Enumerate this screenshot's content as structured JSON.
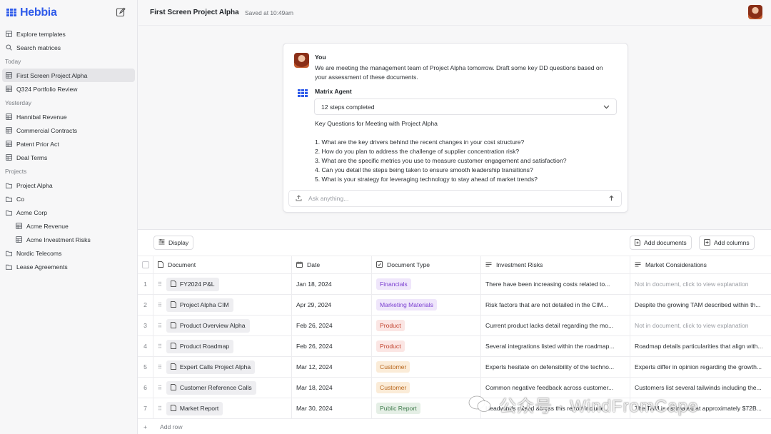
{
  "app": {
    "name": "Hebbia"
  },
  "sidebar": {
    "top_items": [
      {
        "label": "Explore templates",
        "icon": "template-icon"
      },
      {
        "label": "Search matrices",
        "icon": "search-icon"
      }
    ],
    "sections": {
      "today": "Today",
      "yesterday": "Yesterday",
      "projects": "Projects"
    },
    "today_items": [
      {
        "label": "First Screen Project Alpha",
        "active": true
      },
      {
        "label": "Q324 Portfolio Review"
      }
    ],
    "yesterday_items": [
      {
        "label": "Hannibal Revenue"
      },
      {
        "label": "Commercial Contracts"
      },
      {
        "label": "Patent Prior Act"
      },
      {
        "label": "Deal Terms"
      }
    ],
    "project_items": [
      {
        "label": "Project Alpha"
      },
      {
        "label": "Co"
      },
      {
        "label": "Acme Corp"
      },
      {
        "label": "Acme Revenue"
      },
      {
        "label": "Acme Investment Risks"
      },
      {
        "label": "Nordic Telecoms"
      },
      {
        "label": "Lease Agreements"
      }
    ]
  },
  "header": {
    "title": "First Screen Project Alpha",
    "saved": "Saved at 10:49am"
  },
  "chat": {
    "user_name": "You",
    "user_message": "We are meeting the management team of Project Alpha tomorrow. Draft some key DD questions based on your assessment of these documents.",
    "agent_name": "Matrix Agent",
    "steps_label": "12 steps completed",
    "answer_heading": "Key Questions for Meeting with Project Alpha",
    "questions": [
      "1. What are the key drivers behind the recent changes in your cost structure?",
      "2. How do you plan to address the challenge of supplier concentration risk?",
      "3. What are the specific metrics you use to measure customer engagement and satisfaction?",
      "4. Can you detail the steps being taken to ensure smooth leadership transitions?",
      "5. What is your strategy for leveraging technology to stay ahead of market trends?"
    ],
    "ask_placeholder": "Ask anything..."
  },
  "toolbar": {
    "display": "Display",
    "add_documents": "Add documents",
    "add_columns": "Add columns"
  },
  "table": {
    "columns": [
      "Document",
      "Date",
      "Document Type",
      "Investment Risks",
      "Market Considerations"
    ],
    "rows": [
      {
        "num": "1",
        "doc": "FY2024 P&L",
        "date": "Jan 18, 2024",
        "type": "Financials",
        "type_bg": "#efe6fb",
        "type_fg": "#7b3fd1",
        "risk": "There have been increasing costs related to...",
        "market": "Not in document, click to view explanation",
        "market_muted": true
      },
      {
        "num": "2",
        "doc": "Project Alpha CIM",
        "date": "Apr 29, 2024",
        "type": "Marketing Materials",
        "type_bg": "#efe6fb",
        "type_fg": "#7b3fd1",
        "risk": "Risk factors that are not detailed in the CIM...",
        "market": "Despite the growing TAM described within th..."
      },
      {
        "num": "3",
        "doc": "Product Overview Alpha",
        "date": "Feb 26, 2024",
        "type": "Product",
        "type_bg": "#fbe6e4",
        "type_fg": "#c2432f",
        "risk": "Current product lacks detail regarding the mo...",
        "market": "Not in document, click to view explanation",
        "market_muted": true
      },
      {
        "num": "4",
        "doc": "Product Roadmap",
        "date": "Feb 26, 2024",
        "type": "Product",
        "type_bg": "#fbe6e4",
        "type_fg": "#c2432f",
        "risk": "Several integrations listed within the roadmap...",
        "market": "Roadmap details particularities that align with..."
      },
      {
        "num": "5",
        "doc": "Expert Calls Project Alpha",
        "date": "Mar 12, 2024",
        "type": "Customer",
        "type_bg": "#fbecd8",
        "type_fg": "#b7651b",
        "risk": "Experts hesitate on defensibility of the techno...",
        "market": "Experts differ in opinion regarding the growth..."
      },
      {
        "num": "6",
        "doc": "Customer Reference Calls",
        "date": "Mar 18, 2024",
        "type": "Customer",
        "type_bg": "#fbecd8",
        "type_fg": "#b7651b",
        "risk": "Common negative feedback across customer...",
        "market": "Customers list several tailwinds including the..."
      },
      {
        "num": "7",
        "doc": "Market Report",
        "date": "Mar 30, 2024",
        "type": "Public Report",
        "type_bg": "#e5efe6",
        "type_fg": "#3d7a4a",
        "risk": "Headwinds raised across this report include...",
        "market": "The TAM is estimated at approximately $72B..."
      }
    ],
    "add_row": "Add row"
  },
  "watermark": "公众号 · WindFromCape"
}
